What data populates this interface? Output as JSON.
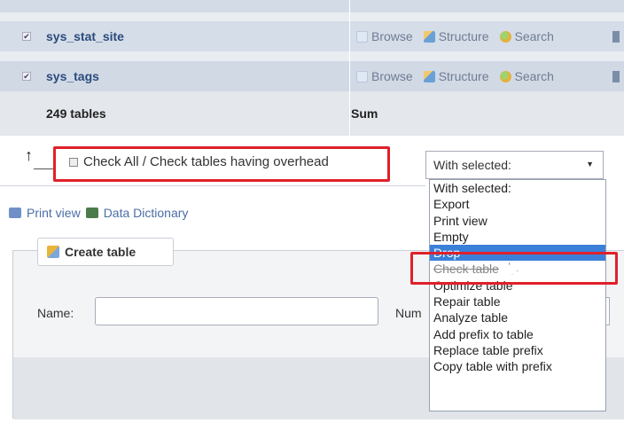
{
  "tables": [
    {
      "name": "sys_stat_site",
      "actions": [
        "Browse",
        "Structure",
        "Search"
      ]
    },
    {
      "name": "sys_tags",
      "actions": [
        "Browse",
        "Structure",
        "Search"
      ]
    }
  ],
  "summary": {
    "tables": "249 tables",
    "label": "Sum"
  },
  "bulk": {
    "check_all_label": "Check All / Check tables having overhead",
    "with_selected": "With selected:"
  },
  "dropdown_options": [
    "With selected:",
    "Export",
    "Print view",
    "Empty",
    "Drop",
    "Check table",
    "Optimize table",
    "Repair table",
    "Analyze table",
    "Add prefix to table",
    "Replace table prefix",
    "Copy table with prefix"
  ],
  "selected_option": "Drop",
  "links": {
    "print_view": "Print view",
    "data_dictionary": "Data Dictionary"
  },
  "create": {
    "title": "Create table",
    "name_label": "Name:",
    "num_label": "Num"
  },
  "colors": {
    "highlight": "#e0202a",
    "row_bg": "#d5dde8",
    "select_bg": "#3a80d9"
  }
}
